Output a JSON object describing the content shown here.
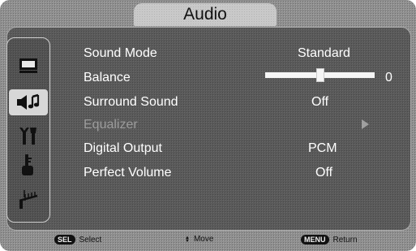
{
  "title": "Audio",
  "menu": {
    "items": [
      {
        "label": "Sound Mode",
        "value": "Standard"
      },
      {
        "label": "Balance",
        "value": "0",
        "slider_fraction": 0.5
      },
      {
        "label": "Surround Sound",
        "value": "Off"
      },
      {
        "label": "Equalizer",
        "value": "",
        "disabled": true
      },
      {
        "label": "Digital Output",
        "value": "PCM"
      },
      {
        "label": "Perfect Volume",
        "value": "Off"
      }
    ]
  },
  "sidebar": {
    "icons": [
      "picture-icon",
      "audio-icon",
      "setup-icon",
      "lock-icon",
      "channel-antenna-icon"
    ],
    "active": "audio-icon"
  },
  "footer": {
    "sel_key": "SEL",
    "select_label": "Select",
    "move_label": "Move",
    "menu_key": "MENU",
    "return_label": "Return"
  }
}
